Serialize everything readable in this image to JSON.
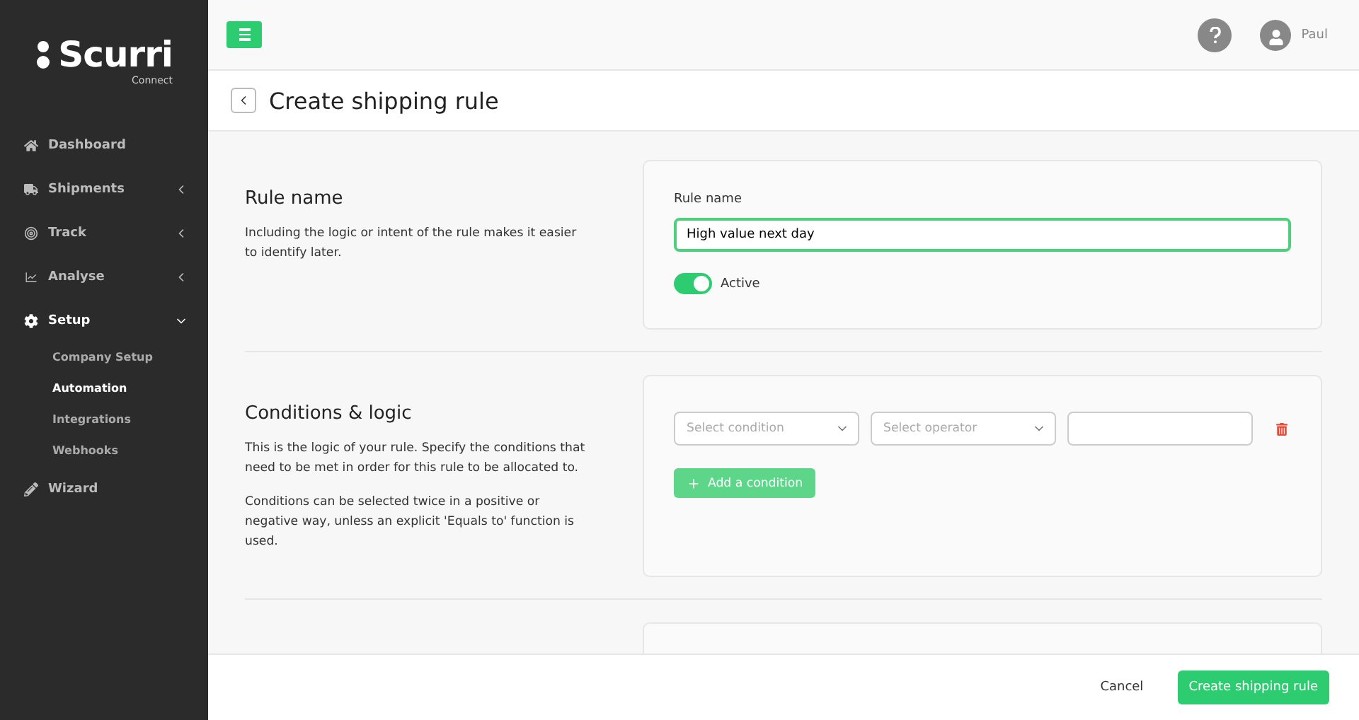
{
  "brand": {
    "name": "Scurri",
    "sub": "Connect"
  },
  "nav": [
    {
      "label": "Dashboard",
      "expandable": false,
      "expanded": false
    },
    {
      "label": "Shipments",
      "expandable": true,
      "expanded": false
    },
    {
      "label": "Track",
      "expandable": true,
      "expanded": false
    },
    {
      "label": "Analyse",
      "expandable": true,
      "expanded": false
    },
    {
      "label": "Setup",
      "expandable": true,
      "expanded": true,
      "children": [
        {
          "label": "Company Setup",
          "selected": false
        },
        {
          "label": "Automation",
          "selected": true
        },
        {
          "label": "Integrations",
          "selected": false
        },
        {
          "label": "Webhooks",
          "selected": false
        }
      ]
    },
    {
      "label": "Wizard",
      "expandable": false,
      "expanded": false
    }
  ],
  "user": {
    "name": "Paul"
  },
  "page_title": "Create shipping rule",
  "rule_section": {
    "title": "Rule name",
    "description": "Including the logic or intent of the rule makes it easier to identify later.",
    "field_label": "Rule name",
    "value": "High value next day",
    "active": {
      "label": "Active",
      "on": true
    }
  },
  "conditions_section": {
    "title": "Conditions & logic",
    "paragraphs": [
      "This is the logic of your rule. Specify the conditions that need to be met in order for this rule to be allocated to.",
      "Conditions can be selected twice in a positive or negative way, unless an explicit 'Equals to' function is used."
    ],
    "condition_placeholder": "Select condition",
    "operator_placeholder": "Select operator",
    "add_button": "Add a condition"
  },
  "footer": {
    "cancel": "Cancel",
    "submit": "Create shipping rule"
  }
}
